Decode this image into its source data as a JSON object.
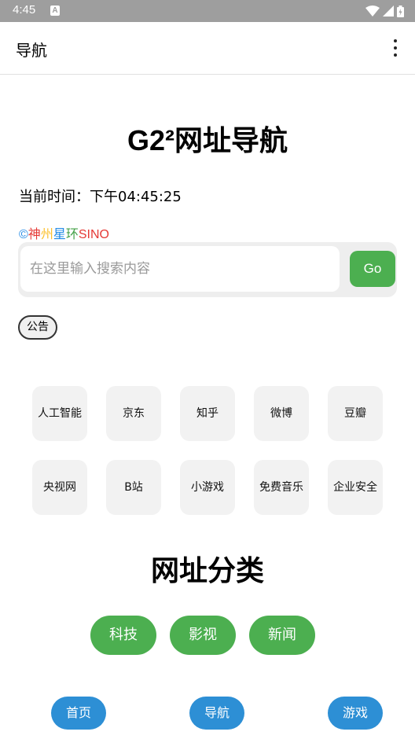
{
  "statusbar": {
    "time": "4:45",
    "notification_icon": "A"
  },
  "appbar": {
    "title": "导航"
  },
  "header": {
    "title": "G2²网址导航"
  },
  "clock": {
    "text": "当前时间：下午04:45:25"
  },
  "copyright": {
    "symbol": "©",
    "parts": [
      "神",
      "州",
      "星",
      "环",
      "SINO"
    ],
    "colors": [
      "#e53935",
      "#fbc02d",
      "#1e88e5",
      "#43a047",
      "#e53935"
    ],
    "symbol_color": "#1e88e5"
  },
  "search": {
    "placeholder": "在这里输入搜索内容",
    "value": "",
    "button": "Go"
  },
  "notice": {
    "label": "公告"
  },
  "quick_links": [
    "人工智能",
    "京东",
    "知乎",
    "微博",
    "豆瓣",
    "央视网",
    "B站",
    "小游戏",
    "免费音乐",
    "企业安全"
  ],
  "categories": {
    "title": "网址分类",
    "items": [
      "科技",
      "影视",
      "新闻"
    ]
  },
  "bottom_nav": [
    "首页",
    "导航",
    "游戏"
  ],
  "colors": {
    "statusbar": "#9e9e9e",
    "green": "#4caf50",
    "blue": "#2d8fd5"
  }
}
